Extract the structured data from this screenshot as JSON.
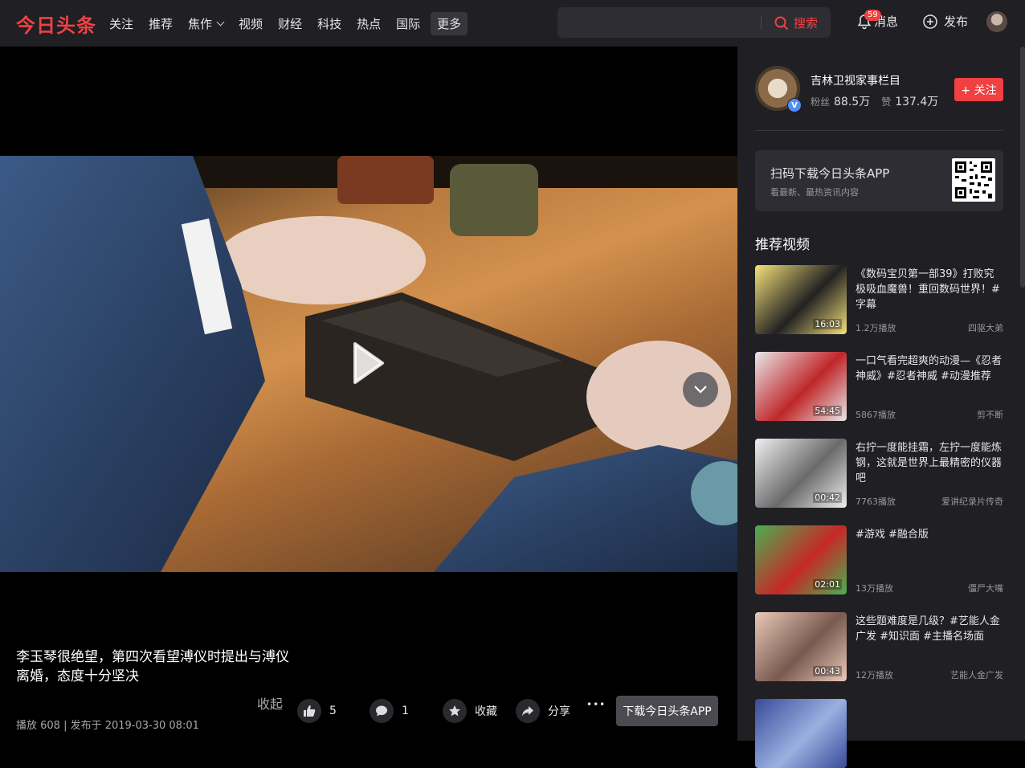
{
  "header": {
    "logo": "今日头条",
    "nav": [
      "关注",
      "推荐",
      "焦作",
      "视频",
      "财经",
      "科技",
      "热点",
      "国际"
    ],
    "more": "更多",
    "search_button": "搜索",
    "search_placeholder": "",
    "messages_label": "消息",
    "messages_count": "59",
    "publish_label": "发布"
  },
  "video": {
    "title": "李玉琴很绝望，第四次看望溥仪时提出与溥仪离婚，态度十分坚决",
    "meta": "播放 608 | 发布于 2019-03-30 08:01",
    "collapse_label": "收起",
    "like_count": "5",
    "comment_count": "1",
    "favorite_label": "收藏",
    "share_label": "分享",
    "more_glyph": "•••",
    "download_label": "下载今日头条APP"
  },
  "author": {
    "name": "吉林卫视家事栏目",
    "fans_label": "粉丝",
    "fans": "88.5万",
    "likes_label": "赞",
    "likes": "137.4万",
    "follow_label": "+ 关注",
    "verified_glyph": "V"
  },
  "qr_card": {
    "title": "扫码下载今日头条APP",
    "subtitle": "看最新、最热资讯内容"
  },
  "recommended": {
    "title": "推荐视频",
    "items": [
      {
        "title": "《数码宝贝第一部39》打败究极吸血魔兽！重回数码世界！#字幕",
        "plays": "1.2万播放",
        "source": "四驱大弟",
        "duration": "16:03",
        "colors": [
          "#f4e27a",
          "#222222"
        ]
      },
      {
        "title": "一口气看完超爽的动漫—《忍者神威》#忍者神威 #动漫推荐",
        "plays": "5867播放",
        "source": "剪不断",
        "duration": "54:45",
        "colors": [
          "#e8e8e8",
          "#c0262a"
        ]
      },
      {
        "title": "右拧一度能挂霜，左拧一度能炼钢，这就是世界上最精密的仪器吧",
        "plays": "7763播放",
        "source": "爱讲纪录片传奇",
        "duration": "00:42",
        "colors": [
          "#f0f0f0",
          "#6a6a6a"
        ]
      },
      {
        "title": "#游戏 #融合版",
        "plays": "13万播放",
        "source": "僵尸大嘴",
        "duration": "02:01",
        "colors": [
          "#4caf50",
          "#c62828"
        ]
      },
      {
        "title": "这些题难度是几级？#艺能人金广发 #知识面 #主播名场面",
        "plays": "12万播放",
        "source": "艺能人金广发",
        "duration": "00:43",
        "colors": [
          "#e9c9b8",
          "#7a5a50"
        ]
      },
      {
        "title": "",
        "plays": "",
        "source": "",
        "duration": "",
        "colors": [
          "#3a4a9a",
          "#9ab0e0"
        ]
      }
    ]
  }
}
